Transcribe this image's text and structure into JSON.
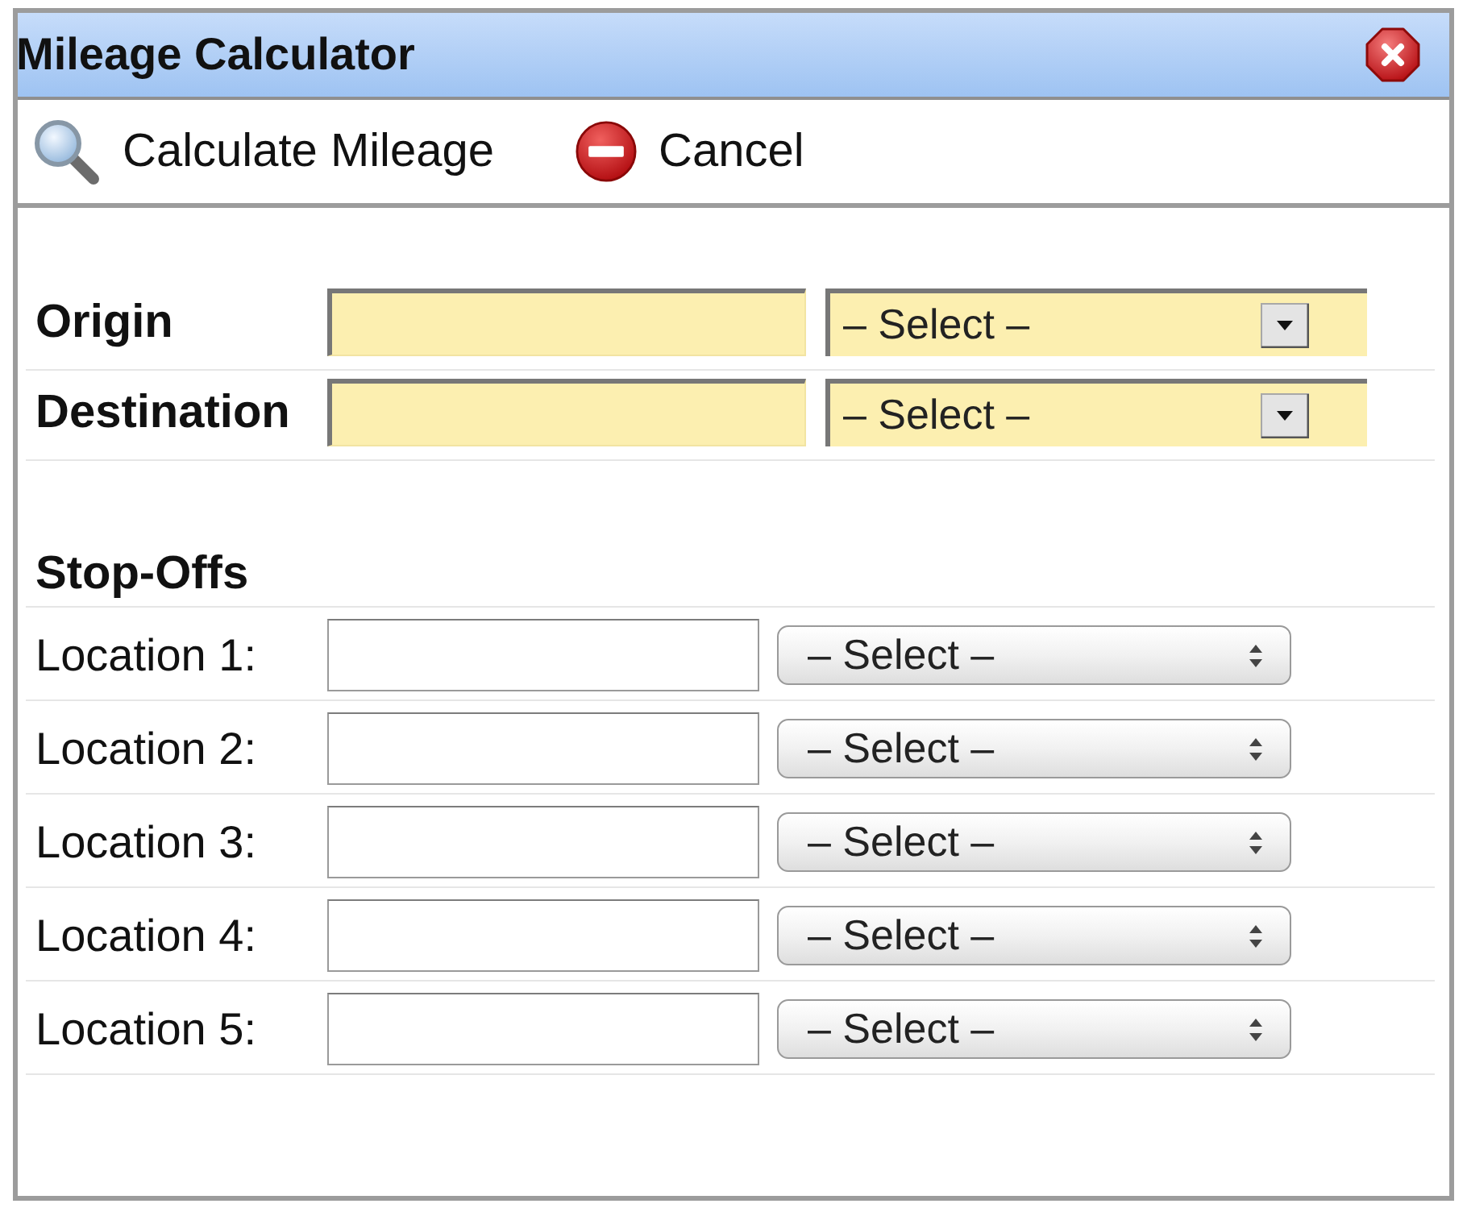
{
  "window": {
    "title": "Mileage Calculator"
  },
  "toolbar": [
    {
      "kind": "search",
      "label": "Calculate Mileage"
    },
    {
      "kind": "cancel",
      "label": "Cancel"
    }
  ],
  "route": [
    {
      "kind": "required",
      "label": "Origin",
      "select": "– Select –"
    },
    {
      "kind": "required",
      "label": "Destination",
      "select": "– Select –"
    }
  ],
  "stop_offs": {
    "heading": "Stop-Offs",
    "rows": [
      {
        "kind": "optional",
        "label": "Location 1:",
        "select": "– Select –"
      },
      {
        "kind": "optional",
        "label": "Location 2:",
        "select": "– Select –"
      },
      {
        "kind": "optional",
        "label": "Location 3:",
        "select": "– Select –"
      },
      {
        "kind": "optional",
        "label": "Location 4:",
        "select": "– Select –"
      },
      {
        "kind": "optional",
        "label": "Location 5:",
        "select": "– Select –"
      }
    ]
  }
}
